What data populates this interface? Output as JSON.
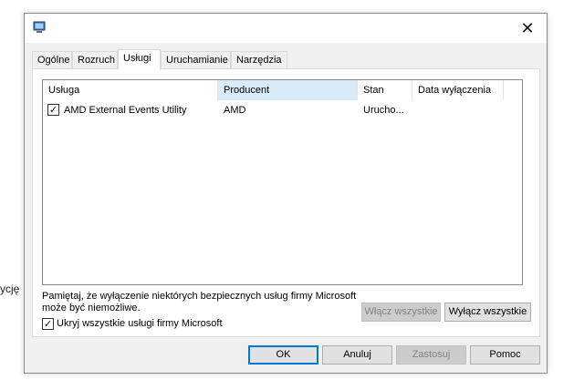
{
  "background": {
    "partial_text": "ycję"
  },
  "window": {
    "close_glyph": "✕",
    "tabs": [
      {
        "label": "Ogólne"
      },
      {
        "label": "Rozruch"
      },
      {
        "label": "Usługi"
      },
      {
        "label": "Uruchamianie"
      },
      {
        "label": "Narzędzia"
      }
    ],
    "active_tab": "Usługi"
  },
  "services": {
    "columns": [
      "Usługa",
      "Producent",
      "Stan",
      "Data wyłączenia"
    ],
    "sorted_column": "Producent",
    "rows": [
      {
        "checked": true,
        "service": "AMD External Events Utility",
        "manufacturer": "AMD",
        "status": "Urucho...",
        "disabled_date": ""
      }
    ]
  },
  "note": "Pamiętaj, że wyłączenie niektórych bezpiecznych usług firmy Microsoft może być niemożliwe.",
  "buttons": {
    "enable_all": "Włącz wszystkie",
    "disable_all": "Wyłącz wszystkie",
    "ok": "OK",
    "cancel": "Anuluj",
    "apply": "Zastosuj",
    "help": "Pomoc"
  },
  "hide_microsoft": {
    "label": "Ukryj wszystkie usługi firmy Microsoft",
    "checked": true
  },
  "colors": {
    "accent": "#0078d7",
    "header_sorted": "#d9ebf9"
  }
}
